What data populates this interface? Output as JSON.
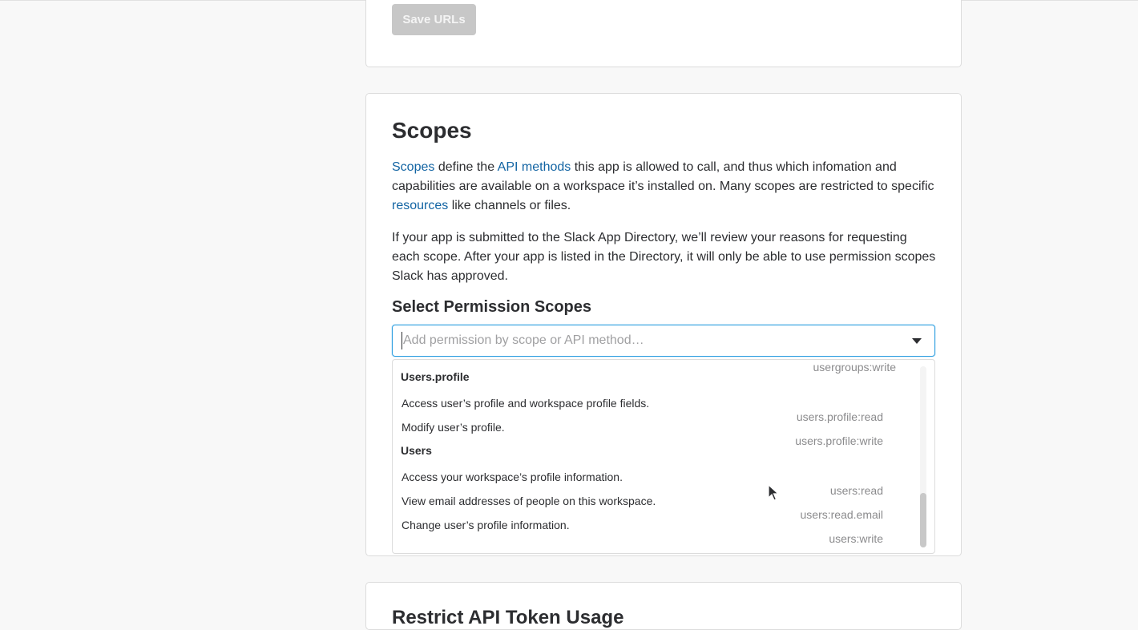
{
  "save_section": {
    "save_button": "Save URLs"
  },
  "scopes_section": {
    "title": "Scopes",
    "para1": {
      "link_scopes": "Scopes",
      "text1": " define the ",
      "link_api_methods": "API methods",
      "text2": " this app is allowed to call, and thus which infomation and capabilities are available on a workspace it’s installed on. Many scopes are restricted to specific ",
      "link_resources": "resources",
      "text3": " like channels or files."
    },
    "para2": "If your app is submitted to the Slack App Directory, we’ll review your reasons for requesting each scope. After your app is listed in the Directory, it will only be able to use permission scopes Slack has approved.",
    "select_heading": "Select Permission Scopes",
    "select_placeholder": "Add permission by scope or API method…"
  },
  "dropdown": {
    "partial_scope": "usergroups:write",
    "groups": [
      {
        "name": "Users.profile",
        "items": [
          {
            "description": "Access user’s profile and workspace profile fields.",
            "scope": "users.profile:read"
          },
          {
            "description": "Modify user’s profile.",
            "scope": "users.profile:write"
          }
        ]
      },
      {
        "name": "Users",
        "items": [
          {
            "description": "Access your workspace’s profile information.",
            "scope": "users:read"
          },
          {
            "description": "View email addresses of people on this workspace.",
            "scope": "users:read.email"
          },
          {
            "description": "Change user’s profile information.",
            "scope": "users:write"
          }
        ]
      }
    ]
  },
  "restrict_section": {
    "title": "Restrict API Token Usage"
  }
}
